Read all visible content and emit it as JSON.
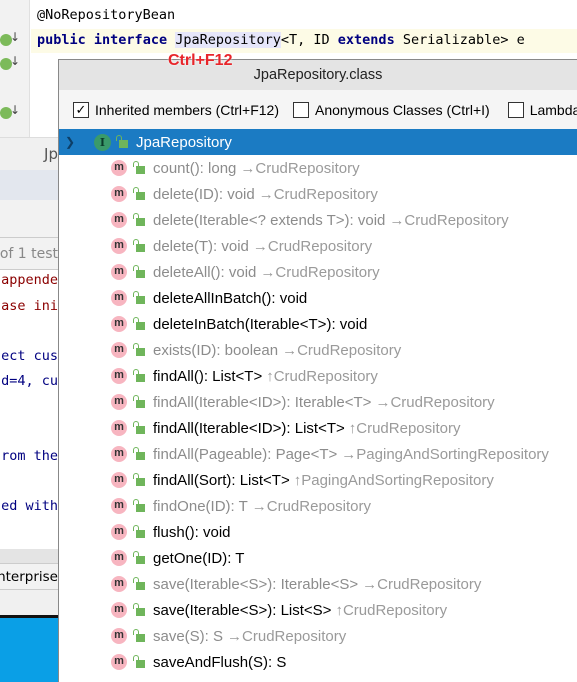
{
  "editor": {
    "line1": "@NoRepositoryBean",
    "kw1": "public",
    "kw2": "interface",
    "classname": "JpaRepository",
    "generic": "<T, ID ",
    "kw3": "extends",
    "rest": " Serializable> e"
  },
  "hint": "Ctrl+F12",
  "background": {
    "tab": "Jp",
    "test": "of 1 test",
    "console": [
      {
        "text": "appende",
        "color": "#8b0000"
      },
      {
        "text": "ase ini",
        "color": "#8b0000"
      },
      {
        "text": "ect cus",
        "color": "#000080"
      },
      {
        "text": "d=4, cu",
        "color": "#000080"
      },
      {
        "text": "rom the",
        "color": "#000080"
      },
      {
        "text": "ed with",
        "color": "#000080"
      }
    ],
    "status": "Enterprise"
  },
  "popup": {
    "title": "JpaRepository.class",
    "checks": [
      {
        "label": "Inherited members (Ctrl+F12)",
        "checked": true
      },
      {
        "label": "Anonymous Classes (Ctrl+I)",
        "checked": false
      },
      {
        "label": "Lambda",
        "checked": false
      }
    ],
    "root": "JpaRepository",
    "members": [
      {
        "sig": "count(): long",
        "via": "→CrudRepository",
        "inherited": true
      },
      {
        "sig": "delete(ID): void",
        "via": "→CrudRepository",
        "inherited": true
      },
      {
        "sig": "delete(Iterable<? extends T>): void",
        "via": "→CrudRepository",
        "inherited": true
      },
      {
        "sig": "delete(T): void",
        "via": "→CrudRepository",
        "inherited": true
      },
      {
        "sig": "deleteAll(): void",
        "via": "→CrudRepository",
        "inherited": true
      },
      {
        "sig": "deleteAllInBatch(): void",
        "via": "",
        "inherited": false
      },
      {
        "sig": "deleteInBatch(Iterable<T>): void",
        "via": "",
        "inherited": false
      },
      {
        "sig": "exists(ID): boolean",
        "via": "→CrudRepository",
        "inherited": true
      },
      {
        "sig": "findAll(): List<T>",
        "via": "↑CrudRepository",
        "inherited": false
      },
      {
        "sig": "findAll(Iterable<ID>): Iterable<T>",
        "via": "→CrudRepository",
        "inherited": true
      },
      {
        "sig": "findAll(Iterable<ID>): List<T>",
        "via": "↑CrudRepository",
        "inherited": false
      },
      {
        "sig": "findAll(Pageable): Page<T>",
        "via": "→PagingAndSortingRepository",
        "inherited": true
      },
      {
        "sig": "findAll(Sort): List<T>",
        "via": "↑PagingAndSortingRepository",
        "inherited": false
      },
      {
        "sig": "findOne(ID): T",
        "via": "→CrudRepository",
        "inherited": true
      },
      {
        "sig": "flush(): void",
        "via": "",
        "inherited": false
      },
      {
        "sig": "getOne(ID): T",
        "via": "",
        "inherited": false
      },
      {
        "sig": "save(Iterable<S>): Iterable<S>",
        "via": "→CrudRepository",
        "inherited": true
      },
      {
        "sig": "save(Iterable<S>): List<S>",
        "via": "↑CrudRepository",
        "inherited": false
      },
      {
        "sig": "save(S): S",
        "via": "→CrudRepository",
        "inherited": true
      },
      {
        "sig": "saveAndFlush(S): S",
        "via": "",
        "inherited": false
      }
    ]
  },
  "colors": {
    "selection": "#1b7bc3",
    "method_icon": "#f7b5c0",
    "lock": "#6fb55b",
    "taskbar": "#0a9fe6"
  }
}
